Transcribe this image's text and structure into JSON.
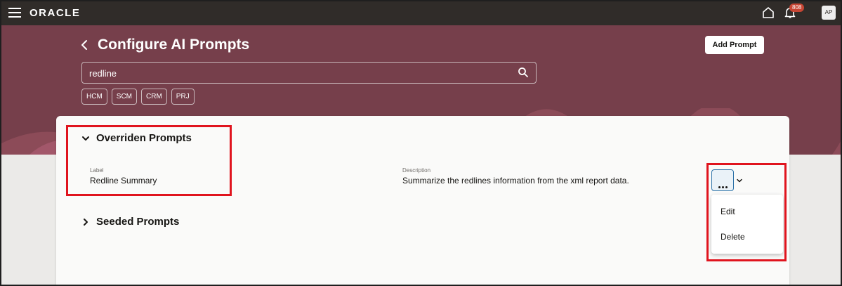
{
  "header": {
    "logo": "ORACLE",
    "notification_count": "808",
    "avatar_initials": "AP"
  },
  "page": {
    "title": "Configure AI Prompts",
    "add_button": "Add Prompt"
  },
  "search": {
    "value": "redline"
  },
  "filters": [
    "HCM",
    "SCM",
    "CRM",
    "PRJ"
  ],
  "sections": {
    "overridden": {
      "title": "Overriden Prompts",
      "label_caption": "Label",
      "label_value": "Redline Summary",
      "description_caption": "Description",
      "description_value": "Summarize the redlines information from the xml report data."
    },
    "seeded": {
      "title": "Seeded Prompts"
    }
  },
  "actions_menu": {
    "items": [
      "Edit",
      "Delete"
    ]
  },
  "colors": {
    "topbar": "#302c29",
    "banner": "#763f4b",
    "highlight": "#e0141e"
  }
}
